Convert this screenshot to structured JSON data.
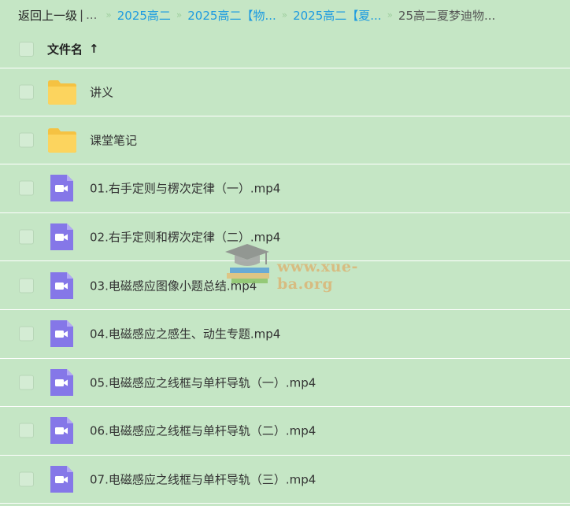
{
  "breadcrumb": {
    "back_label": "返回上一级",
    "separator": "|",
    "ellipsis": "...",
    "arrow": "»",
    "links": [
      "2025高二",
      "2025高二【物...",
      "2025高二【夏..."
    ],
    "current": "25高二夏梦迪物..."
  },
  "header": {
    "column_label": "文件名",
    "sort_icon": "arrow-up-icon"
  },
  "files": [
    {
      "name": "讲义",
      "type": "folder"
    },
    {
      "name": "课堂笔记",
      "type": "folder"
    },
    {
      "name": "01.右手定则与楞次定律（一）.mp4",
      "type": "video"
    },
    {
      "name": "02.右手定则和楞次定律（二）.mp4",
      "type": "video"
    },
    {
      "name": "03.电磁感应图像小题总结.mp4",
      "type": "video"
    },
    {
      "name": "04.电磁感应之感生、动生专题.mp4",
      "type": "video"
    },
    {
      "name": "05.电磁感应之线框与单杆导轨（一）.mp4",
      "type": "video"
    },
    {
      "name": "06.电磁感应之线框与单杆导轨（二）.mp4",
      "type": "video"
    },
    {
      "name": "07.电磁感应之线框与单杆导轨（三）.mp4",
      "type": "video"
    }
  ],
  "watermark": {
    "text": "www.xue-ba.org"
  },
  "colors": {
    "background": "#c5e6c5",
    "link": "#1d9be0",
    "folder": "#f9cf57",
    "video": "#8577e8"
  }
}
